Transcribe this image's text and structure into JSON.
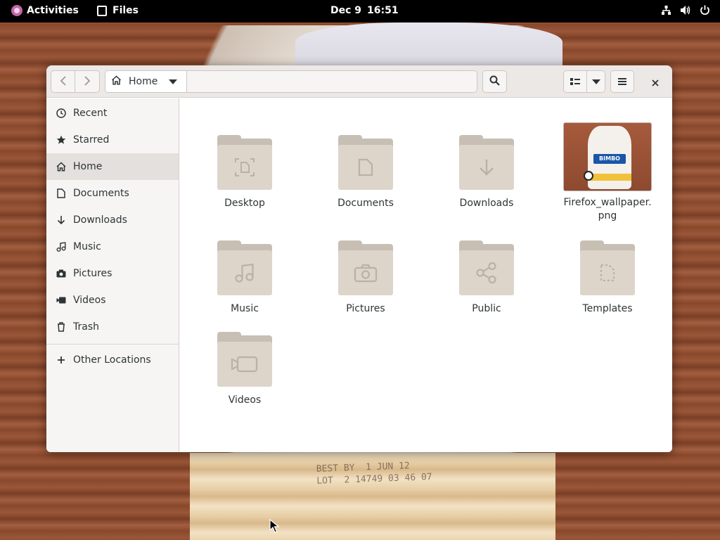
{
  "topbar": {
    "activities_label": "Activities",
    "app_name": "Files",
    "date": "Dec 9",
    "time": "16:51"
  },
  "wallpaper": {
    "bread_text": "BEST BY  1 JUN 12\nLOT  2 14749 03 46 07"
  },
  "window": {
    "path_label": "Home",
    "icons": {
      "back": "chevron-left-icon",
      "forward": "chevron-right-icon",
      "home": "home-icon",
      "search": "search-icon",
      "list_view": "list-view-icon",
      "view_options": "chevron-down-icon",
      "menu": "hamburger-menu-icon",
      "close": "close-icon"
    }
  },
  "sidebar": {
    "items": [
      {
        "label": "Recent",
        "icon": "clock-icon"
      },
      {
        "label": "Starred",
        "icon": "star-icon"
      },
      {
        "label": "Home",
        "icon": "home-icon",
        "active": true
      },
      {
        "label": "Documents",
        "icon": "document-icon"
      },
      {
        "label": "Downloads",
        "icon": "download-icon"
      },
      {
        "label": "Music",
        "icon": "music-icon"
      },
      {
        "label": "Pictures",
        "icon": "camera-icon"
      },
      {
        "label": "Videos",
        "icon": "video-icon"
      },
      {
        "label": "Trash",
        "icon": "trash-icon"
      }
    ],
    "other_locations": {
      "label": "Other Locations",
      "icon": "plus-icon"
    }
  },
  "files": [
    {
      "name": "Desktop",
      "type": "folder",
      "icon": "desktop-icon"
    },
    {
      "name": "Documents",
      "type": "folder",
      "icon": "document-icon"
    },
    {
      "name": "Downloads",
      "type": "folder",
      "icon": "download-icon"
    },
    {
      "name": "Firefox_wallpaper.png",
      "name_line1": "Firefox_wallpaper.",
      "name_line2": "png",
      "type": "image",
      "thumb_text": "BIMBO"
    },
    {
      "name": "Music",
      "type": "folder",
      "icon": "music-icon"
    },
    {
      "name": "Pictures",
      "type": "folder",
      "icon": "camera-icon"
    },
    {
      "name": "Public",
      "type": "folder",
      "icon": "share-icon"
    },
    {
      "name": "Templates",
      "type": "folder",
      "icon": "template-icon"
    },
    {
      "name": "Videos",
      "type": "folder",
      "icon": "video-icon"
    }
  ],
  "colors": {
    "topbar": "#000000",
    "folder_front": "#ddd5ca",
    "folder_back": "#c7bfb4",
    "sidebar_bg": "#f6f5f4",
    "sidebar_active": "#e3e0dd"
  }
}
